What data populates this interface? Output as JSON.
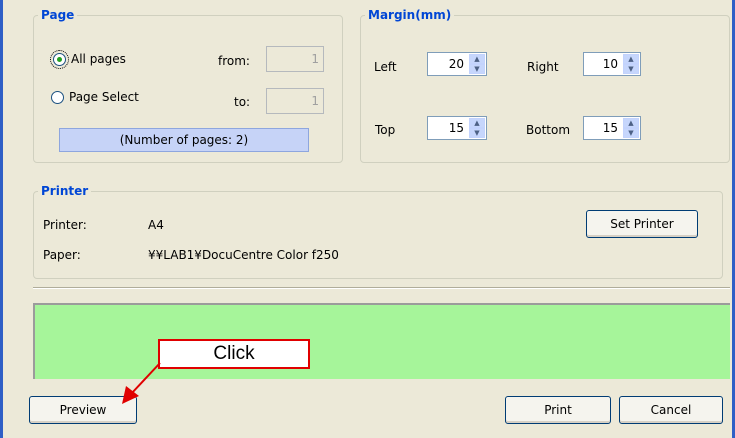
{
  "page_group": {
    "legend": "Page",
    "all_pages_label": "All pages",
    "page_select_label": "Page Select",
    "from_label": "from:",
    "to_label": "to:",
    "from_value": "1",
    "to_value": "1",
    "pages_info": "(Number of pages: 2)"
  },
  "margin_group": {
    "legend": "Margin(mm)",
    "left_label": "Left",
    "left_value": "20",
    "right_label": "Right",
    "right_value": "10",
    "top_label": "Top",
    "top_value": "15",
    "bottom_label": "Bottom",
    "bottom_value": "15"
  },
  "printer_group": {
    "legend": "Printer",
    "printer_label": "Printer:",
    "printer_value": "A4",
    "paper_label": "Paper:",
    "paper_value": "¥¥LAB1¥DocuCentre Color f250",
    "set_printer_button": "Set Printer"
  },
  "buttons": {
    "preview": "Preview",
    "print": "Print",
    "cancel": "Cancel"
  },
  "callout": {
    "text": "Click"
  },
  "colors": {
    "legend": "#0046d5",
    "preview_area": "#a6f59a",
    "annotation": "#e00000"
  }
}
